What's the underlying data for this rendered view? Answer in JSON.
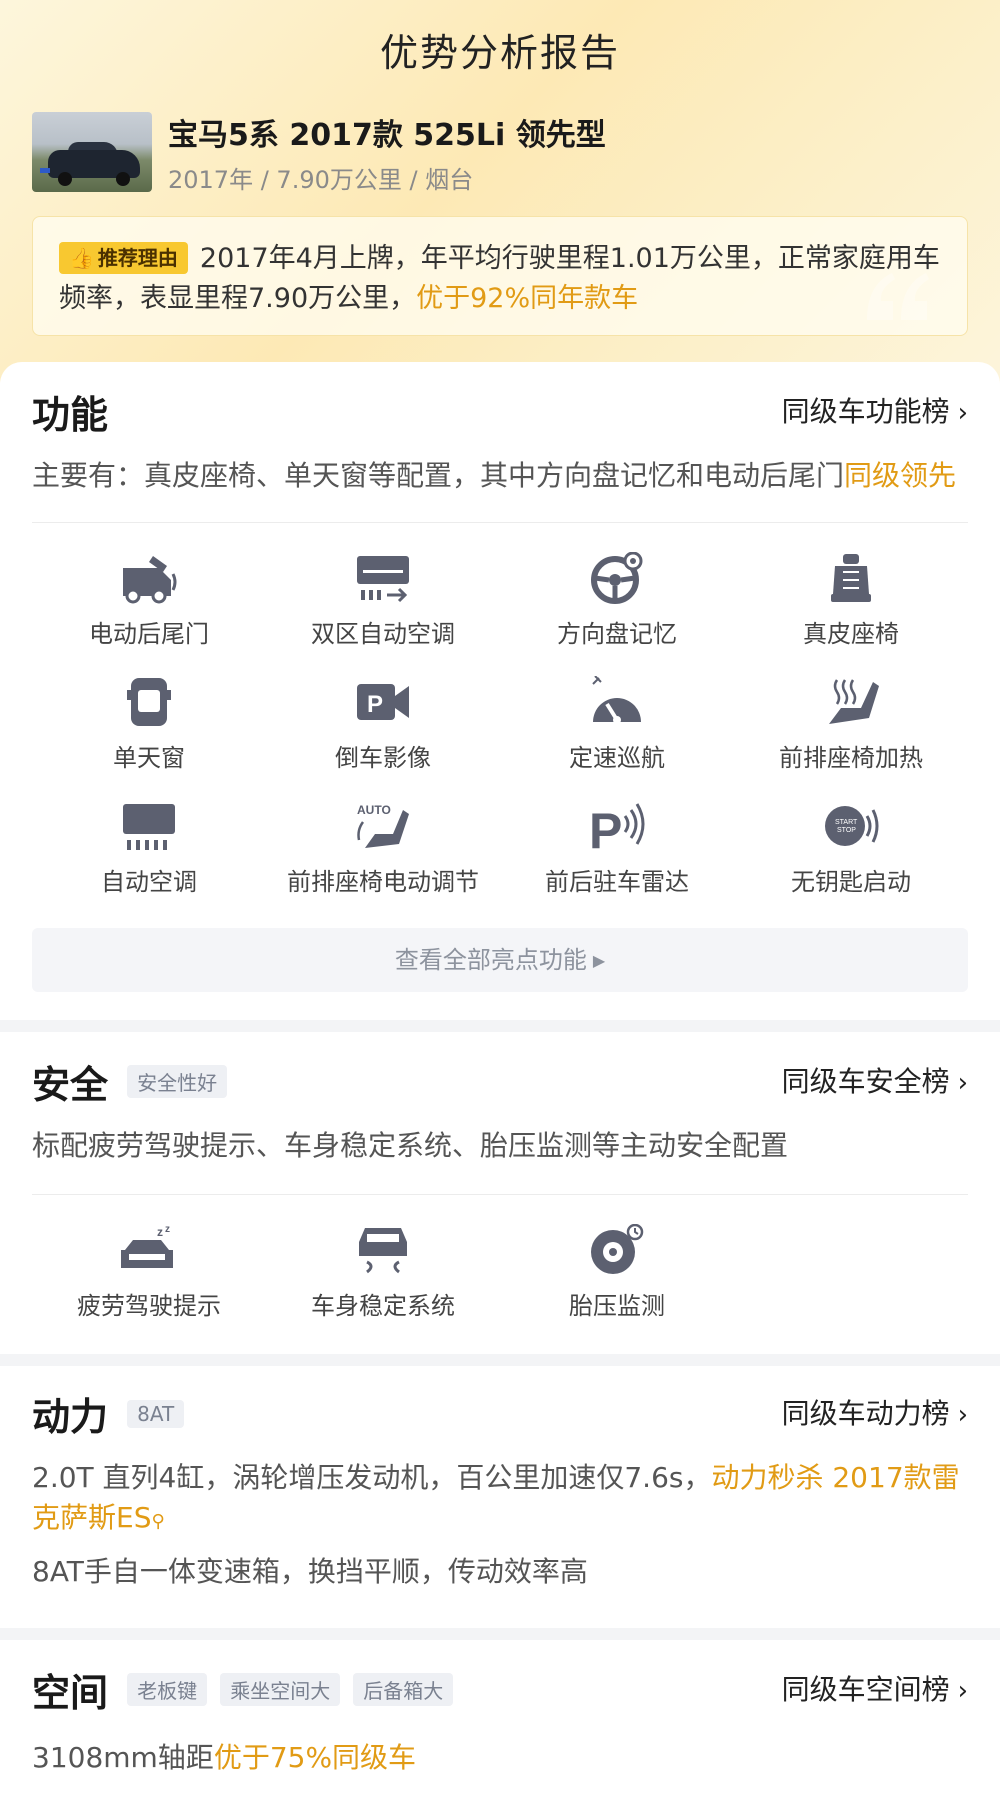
{
  "page": {
    "title": "优势分析报告"
  },
  "car": {
    "name": "宝马5系 2017款 525Li 领先型",
    "meta": "2017年 / 7.90万公里 / 烟台"
  },
  "reason": {
    "tag": "推荐理由",
    "text": "2017年4月上牌，年平均行驶里程1.01万公里，正常家庭用车频率，表显里程7.90万公里，",
    "highlight": "优于92%同年款车"
  },
  "features": {
    "title": "功能",
    "link": "同级车功能榜",
    "desc": "主要有：真皮座椅、单天窗等配置，其中方向盘记忆和电动后尾门",
    "desc_highlight": "同级领先",
    "items": [
      {
        "label": "电动后尾门",
        "icon": "power-tailgate-icon"
      },
      {
        "label": "双区自动空调",
        "icon": "dual-zone-ac-icon"
      },
      {
        "label": "方向盘记忆",
        "icon": "steering-memory-icon"
      },
      {
        "label": "真皮座椅",
        "icon": "leather-seat-icon"
      },
      {
        "label": "单天窗",
        "icon": "sunroof-icon"
      },
      {
        "label": "倒车影像",
        "icon": "reverse-camera-icon"
      },
      {
        "label": "定速巡航",
        "icon": "cruise-control-icon"
      },
      {
        "label": "前排座椅加热",
        "icon": "seat-heating-icon"
      },
      {
        "label": "自动空调",
        "icon": "auto-ac-icon"
      },
      {
        "label": "前排座椅电动调节",
        "icon": "power-seat-icon"
      },
      {
        "label": "前后驻车雷达",
        "icon": "parking-radar-icon"
      },
      {
        "label": "无钥匙启动",
        "icon": "keyless-start-icon"
      }
    ],
    "more": "查看全部亮点功能"
  },
  "safety": {
    "title": "安全",
    "tag": "安全性好",
    "link": "同级车安全榜",
    "desc": "标配疲劳驾驶提示、车身稳定系统、胎压监测等主动安全配置",
    "items": [
      {
        "label": "疲劳驾驶提示",
        "icon": "fatigue-warning-icon"
      },
      {
        "label": "车身稳定系统",
        "icon": "stability-control-icon"
      },
      {
        "label": "胎压监测",
        "icon": "tire-pressure-icon"
      }
    ]
  },
  "power": {
    "title": "动力",
    "tag": "8AT",
    "link": "同级车动力榜",
    "desc1": "2.0T 直列4缸，涡轮增压发动机，百公里加速仅7.6s，",
    "desc1_highlight": "动力秒杀 2017款雷克萨斯ES",
    "desc2": "8AT手自一体变速箱，换挡平顺，传动效率高"
  },
  "space": {
    "title": "空间",
    "tags": [
      "老板键",
      "乘坐空间大",
      "后备箱大"
    ],
    "link": "同级车空间榜",
    "desc": "3108mm轴距",
    "desc_highlight": "优于75%同级车"
  }
}
